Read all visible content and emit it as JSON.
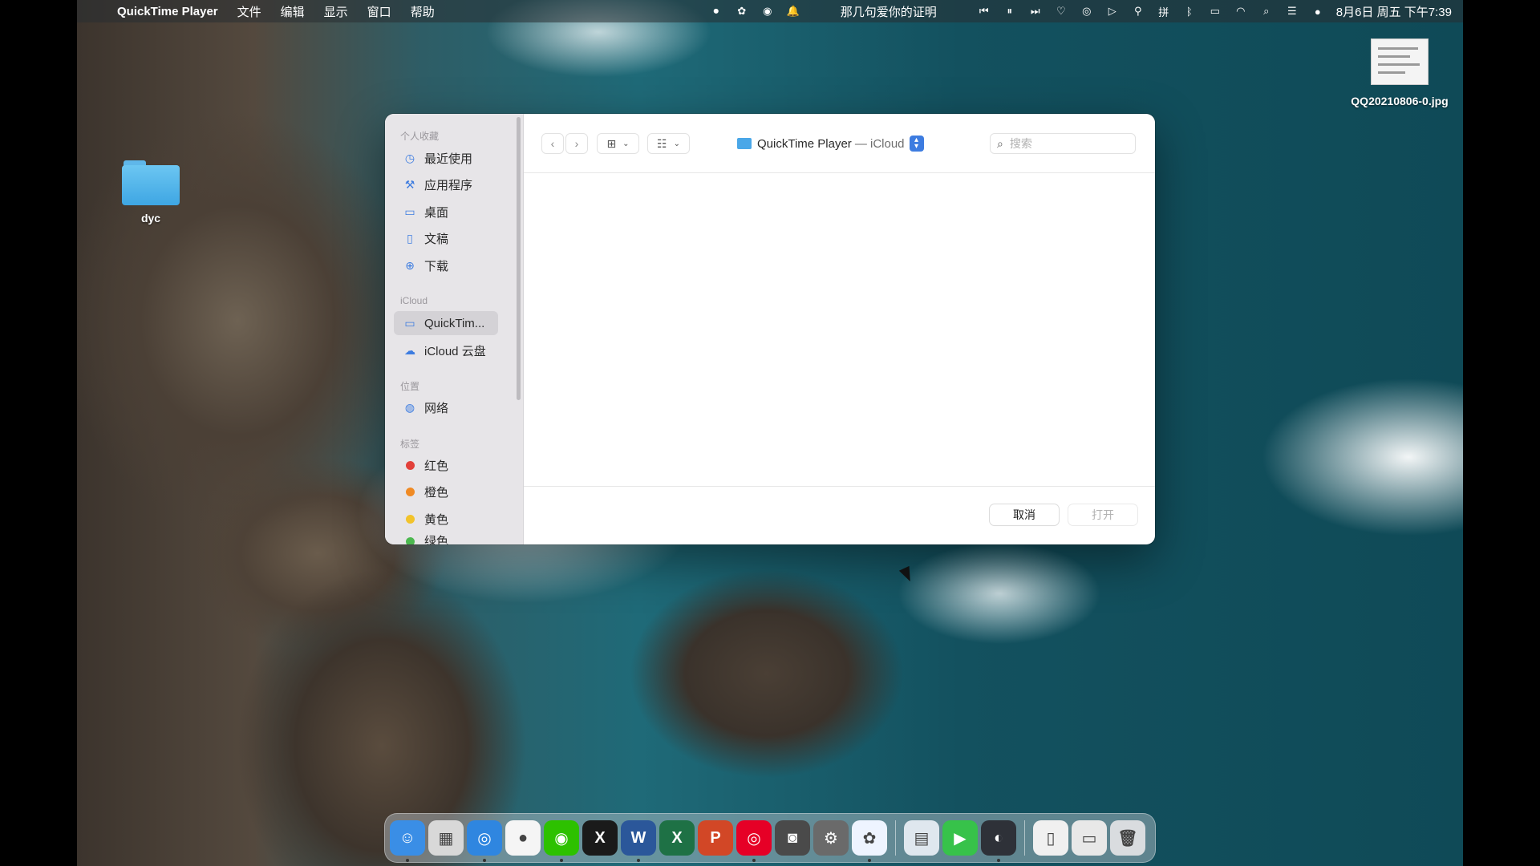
{
  "menubar": {
    "app_name": "QuickTime Player",
    "menus": [
      "文件",
      "编辑",
      "显示",
      "窗口",
      "帮助"
    ],
    "now_playing": "那几句爱你的证明",
    "datetime": "8月6日 周五 下午7:39"
  },
  "desktop": {
    "folder_label": "dyc",
    "file_label": "QQ20210806-0.jpg"
  },
  "dialog": {
    "sidebar": {
      "favorites_title": "个人收藏",
      "favorites": [
        "最近使用",
        "应用程序",
        "桌面",
        "文稿",
        "下载"
      ],
      "icloud_title": "iCloud",
      "icloud_items": [
        "QuickTim...",
        "iCloud 云盘"
      ],
      "locations_title": "位置",
      "locations": [
        "网络"
      ],
      "tags_title": "标签",
      "tags": [
        {
          "label": "红色",
          "color": "#e2403a"
        },
        {
          "label": "橙色",
          "color": "#f08a24"
        },
        {
          "label": "黄色",
          "color": "#f2c32b"
        },
        {
          "label": "绿色",
          "color": "#4cb84f"
        }
      ]
    },
    "path": {
      "name": "QuickTime Player",
      "suffix": "— iCloud"
    },
    "search_placeholder": "搜索",
    "cancel_label": "取消",
    "open_label": "打开"
  },
  "dock": {
    "apps": [
      {
        "name": "finder",
        "color": "#3a8ee6",
        "glyph": "☺"
      },
      {
        "name": "launchpad",
        "color": "#d8d8d8",
        "glyph": "▦"
      },
      {
        "name": "safari",
        "color": "#2f86e0",
        "glyph": "◎"
      },
      {
        "name": "qq",
        "color": "#f5f5f5",
        "glyph": "●"
      },
      {
        "name": "wechat",
        "color": "#2dc100",
        "glyph": "◉"
      },
      {
        "name": "capcut",
        "color": "#1a1a1a",
        "glyph": "X"
      },
      {
        "name": "word",
        "color": "#2b579a",
        "glyph": "W"
      },
      {
        "name": "excel",
        "color": "#1e7145",
        "glyph": "X"
      },
      {
        "name": "powerpoint",
        "color": "#d24726",
        "glyph": "P"
      },
      {
        "name": "netease-music",
        "color": "#e60026",
        "glyph": "◎"
      },
      {
        "name": "screenshot",
        "color": "#4a4a4a",
        "glyph": "◙"
      },
      {
        "name": "system-preferences",
        "color": "#6a6a6a",
        "glyph": "⚙"
      },
      {
        "name": "baidu-netdisk",
        "color": "#eef4ff",
        "glyph": "✿"
      },
      {
        "name": "preview",
        "color": "#dfe7ee",
        "glyph": "▤"
      },
      {
        "name": "facetime",
        "color": "#37c24a",
        "glyph": "▶"
      },
      {
        "name": "quicktime",
        "color": "#2e3138",
        "glyph": "◐"
      },
      {
        "name": "documents",
        "color": "#f0f0f0",
        "glyph": "▯"
      },
      {
        "name": "downloads-stack",
        "color": "#e8e8e8",
        "glyph": "▭"
      },
      {
        "name": "trash",
        "color": "#d9dcdf",
        "glyph": "🗑"
      }
    ]
  }
}
